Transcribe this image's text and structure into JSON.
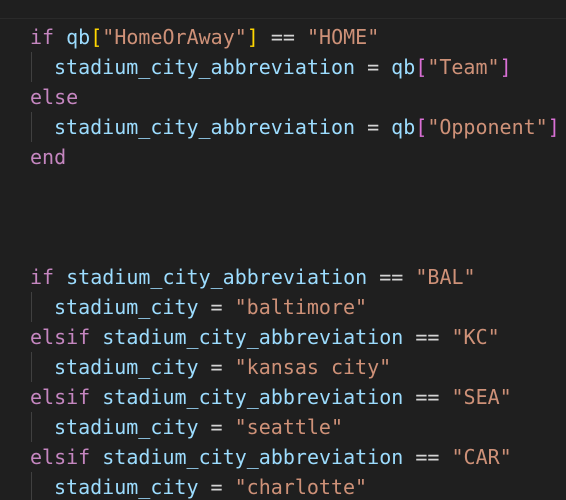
{
  "lines": {
    "l1": {
      "kw": "if",
      "var": "qb",
      "br_open": "[",
      "str": "\"HomeOrAway\"",
      "br_close": "]",
      "op": "==",
      "str2": "\"HOME\""
    },
    "l2": {
      "var": "stadium_city_abbreviation",
      "op": "=",
      "var2": "qb",
      "br_open": "[",
      "str": "\"Team\"",
      "br_close": "]"
    },
    "l3": {
      "kw": "else"
    },
    "l4": {
      "var": "stadium_city_abbreviation",
      "op": "=",
      "var2": "qb",
      "br_open": "[",
      "str": "\"Opponent\"",
      "br_close": "]"
    },
    "l5": {
      "kw": "end"
    },
    "l6": {
      "kw": "if",
      "var": "stadium_city_abbreviation",
      "op": "==",
      "str": "\"BAL\""
    },
    "l7": {
      "var": "stadium_city",
      "op": "=",
      "str": "\"baltimore\""
    },
    "l8": {
      "kw": "elsif",
      "var": "stadium_city_abbreviation",
      "op": "==",
      "str": "\"KC\""
    },
    "l9": {
      "var": "stadium_city",
      "op": "=",
      "str": "\"kansas city\""
    },
    "l10": {
      "kw": "elsif",
      "var": "stadium_city_abbreviation",
      "op": "==",
      "str": "\"SEA\""
    },
    "l11": {
      "var": "stadium_city",
      "op": "=",
      "str": "\"seattle\""
    },
    "l12": {
      "kw": "elsif",
      "var": "stadium_city_abbreviation",
      "op": "==",
      "str": "\"CAR\""
    },
    "l13": {
      "var": "stadium_city",
      "op": "=",
      "str": "\"charlotte\""
    }
  },
  "colors": {
    "background": "#1f1f1f",
    "keyword": "#c586c0",
    "variable": "#9cdcfe",
    "string": "#ce9178",
    "bracket": "#ffd700",
    "bracket_nested": "#da70d6"
  }
}
